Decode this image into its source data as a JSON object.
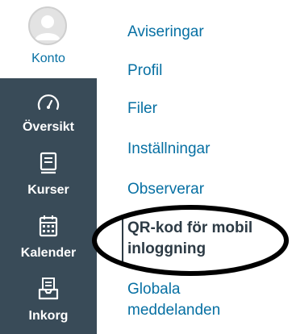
{
  "account": {
    "label": "Konto",
    "icon": "user-avatar-icon"
  },
  "global_nav": {
    "items": [
      {
        "label": "Översikt",
        "icon": "dashboard-gauge-icon"
      },
      {
        "label": "Kurser",
        "icon": "book-icon"
      },
      {
        "label": "Kalender",
        "icon": "calendar-icon"
      },
      {
        "label": "Inkorg",
        "icon": "inbox-icon"
      }
    ]
  },
  "sub_nav": {
    "items": [
      {
        "label": "Aviseringar"
      },
      {
        "label": "Profil"
      },
      {
        "label": "Filer"
      },
      {
        "label": "Inställningar"
      },
      {
        "label": "Observerar"
      },
      {
        "label_line1": "QR-kod för mobil",
        "label_line2": "inloggning",
        "active": true
      },
      {
        "label_line1": "Globala",
        "label_line2": "meddelanden"
      }
    ]
  },
  "colors": {
    "nav_background": "#394b58",
    "link": "#0770a3",
    "active_text": "#2d3b45",
    "annotation_ring": "#000000"
  }
}
